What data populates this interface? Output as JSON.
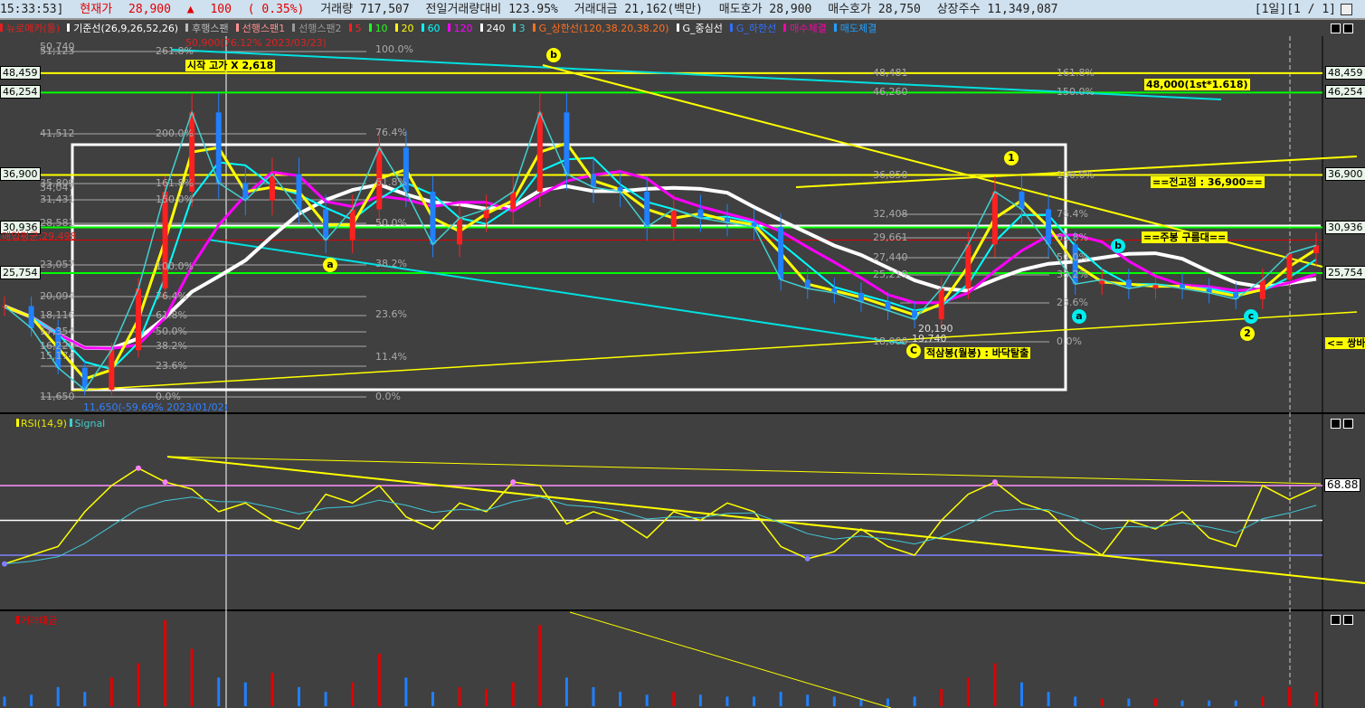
{
  "topbar": {
    "time": "15:33:53]",
    "price_label": "현재가",
    "price": "28,900",
    "arrow": "▲",
    "change": "100",
    "change_pct": "( 0.35%)",
    "volume": "거래량 717,507",
    "vol_ratio": "전일거래량대비 123.95%",
    "amount": "거래대금 21,162(백만)",
    "ask": "매도호가 28,900",
    "bid": "매수호가 28,750",
    "shares": "상장주수 11,349,087",
    "period": "[1일][1 / 1]"
  },
  "legend": [
    {
      "label": "뉴로메카(통)",
      "color": "#e02020"
    },
    {
      "label": "기준선(26,9,26,52,26)",
      "color": "#ffffff"
    },
    {
      "label": "후행스팬",
      "color": "#bbbbbb"
    },
    {
      "label": "선행스팬1",
      "color": "#ff9090"
    },
    {
      "label": "선행스팬2",
      "color": "#999999"
    },
    {
      "label": "5",
      "color": "#ff2020"
    },
    {
      "label": "10",
      "color": "#20ff20"
    },
    {
      "label": "20",
      "color": "#ffff00"
    },
    {
      "label": "60",
      "color": "#00ffff"
    },
    {
      "label": "120",
      "color": "#ff00ff"
    },
    {
      "label": "240",
      "color": "#ffffff"
    },
    {
      "label": "3",
      "color": "#40d0d0"
    },
    {
      "label": "G_상한선(120,38.20,38.20)",
      "color": "#ff7020"
    },
    {
      "label": "G_중심선",
      "color": "#ffffff"
    },
    {
      "label": "G_하한선",
      "color": "#3070ff"
    },
    {
      "label": "매수체결",
      "color": "#ff00aa"
    },
    {
      "label": "매도체결",
      "color": "#20a0ff"
    }
  ],
  "rsi_legend": {
    "rsi": "RSI(14,9)",
    "signal": "Signal"
  },
  "volume_legend": "거래대금",
  "right_axis": [
    "48,459",
    "46,254",
    "36,900",
    "30,936",
    "25,754"
  ],
  "left_axis": [
    "48,459",
    "46,254",
    "36,900",
    "30,936",
    "25,754"
  ],
  "rsi_value": "68.88",
  "fib_left_prices": [
    "51,123",
    "50,740",
    "41,512",
    "35,809",
    "34,047",
    "31,431",
    "28,581",
    "23,057",
    "20,094",
    "18,116",
    "17,354",
    "16,229",
    "15,174",
    "11,650"
  ],
  "fib_left_pcts": [
    "261.8%",
    "200.0%",
    "161.8%",
    "150.0%",
    "100.0%",
    "76.4%",
    "61.8%",
    "50.0%",
    "38.2%",
    "23.6%",
    "0.0%"
  ],
  "fib_mid_pcts": [
    "100.0%",
    "76.4%",
    "61.8%",
    "50.0%",
    "38.2%",
    "23.6%",
    "11.4%",
    "0.0%"
  ],
  "fib_right": [
    {
      "p": "48,481",
      "pct": "161.8%"
    },
    {
      "p": "46,260",
      "pct": "150.0%"
    },
    {
      "p": "36,850",
      "pct": "100.0%"
    },
    {
      "p": "32,408",
      "pct": "76.4%"
    },
    {
      "p": "29,661",
      "pct": "61.8%"
    },
    {
      "p": "27,440",
      "pct": "50.0%"
    },
    {
      "p": "25,219",
      "pct": "38.2%"
    },
    {
      "p": "",
      "pct": "23.6%"
    },
    {
      "p": "18,000",
      "pct": "0.0%"
    }
  ],
  "annotations": {
    "start_high": "시작 고가 X 2,618",
    "target": "48,000(1st*1.618)",
    "prev_high": "==전고점 : 36,900==",
    "weekly_cloud": "==주봉 구름대==",
    "red_three": "적삼봉(월봉) : 바닥탈출",
    "double_bottom": "<= 쌍바",
    "high_info": "50,900(76.12% 2023/03/23)",
    "low_info": "11,650(-59.69% 2023/01/02)",
    "avg_price": "매입평균:29,498",
    "low1": "20,190",
    "low2": "19,740"
  },
  "wave_labels": {
    "a": "a",
    "b": "b",
    "one": "1",
    "two": "2",
    "c_big": "C",
    "ca": "a",
    "cb": "b",
    "cc": "c"
  },
  "chart_data": {
    "type": "line",
    "title": "뉴로메카 일봉",
    "y_levels": {
      "48459": "yellow",
      "46254": "green",
      "36900": "yellow",
      "30936": "green",
      "25754": "green",
      "29498": "red"
    },
    "close": [
      22000,
      19500,
      15000,
      12500,
      17000,
      24000,
      35000,
      44000,
      36000,
      34000,
      37000,
      33000,
      29500,
      33000,
      40000,
      35000,
      29000,
      32000,
      33000,
      35000,
      44000,
      37000,
      35500,
      35000,
      31000,
      33000,
      32000,
      31500,
      31000,
      25000,
      24000,
      23500,
      22500,
      21500,
      20500,
      24000,
      29000,
      35000,
      33000,
      29000,
      24500,
      25000,
      24000,
      24500,
      24000,
      23500,
      22800,
      25000,
      28000,
      28900
    ],
    "rsi": [
      25,
      30,
      35,
      55,
      70,
      80,
      72,
      68,
      55,
      60,
      50,
      45,
      65,
      60,
      70,
      52,
      45,
      60,
      55,
      72,
      70,
      48,
      55,
      50,
      40,
      55,
      50,
      60,
      55,
      35,
      28,
      32,
      45,
      35,
      30,
      50,
      65,
      72,
      60,
      55,
      40,
      30,
      50,
      45,
      55,
      40,
      35,
      70,
      62,
      68.88
    ],
    "rsi_levels": [
      70,
      50,
      30
    ],
    "volume": [
      10,
      12,
      20,
      15,
      30,
      45,
      90,
      60,
      30,
      25,
      35,
      20,
      15,
      25,
      55,
      30,
      15,
      20,
      18,
      25,
      85,
      30,
      20,
      15,
      12,
      15,
      12,
      10,
      10,
      15,
      12,
      10,
      8,
      8,
      10,
      18,
      30,
      45,
      25,
      15,
      10,
      8,
      8,
      8,
      6,
      6,
      6,
      10,
      20,
      15
    ]
  }
}
